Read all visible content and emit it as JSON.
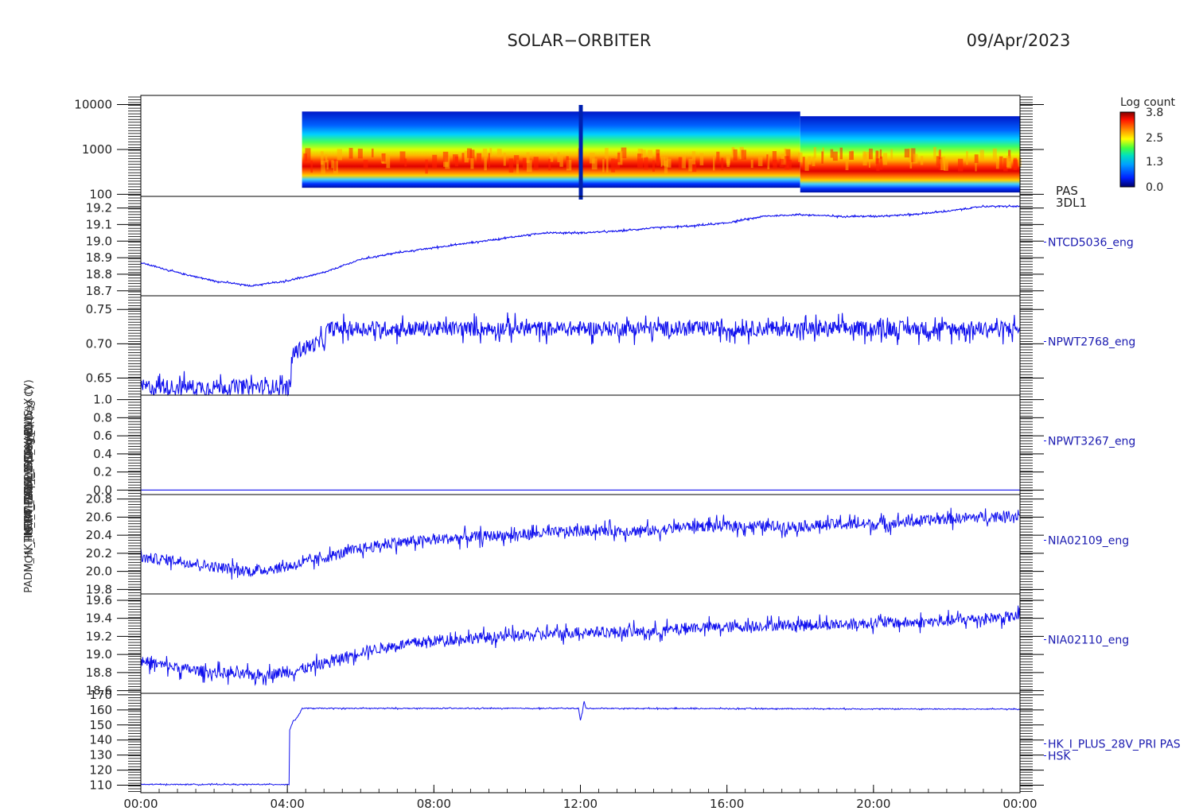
{
  "header": {
    "title": "SOLAR−ORBITER",
    "date": "09/Apr/2023"
  },
  "colorbar": {
    "label": "Log count",
    "ticks": [
      "3.8",
      "2.5",
      "1.3",
      "0.0"
    ],
    "values": [
      3.8,
      2.5,
      1.3,
      0.0
    ]
  },
  "colors": {
    "trace": "#1010ee",
    "axis": "#000000"
  },
  "stacked_ylabels": [
    "(eV)",
    "Approx Temp (Deg C)",
    "PWT_TEMP_EBOX_PLUS_X (V)",
    "SWA_EAS_LVPS_5V_C (V)",
    "THERM_ACU_1 (Deg C)",
    "MON_HK_I_THERM_2 (Deg C)",
    "PADM_HK_IMON_PLUS28V (mA)"
  ],
  "chart_data": [
    {
      "type": "heatmap",
      "panel": "spectrogram",
      "side_labels": [
        "PAS",
        "3DL1"
      ],
      "ylabel": "(eV)",
      "yscale": "log",
      "ylim": [
        90,
        16000
      ],
      "yticks": [
        100,
        1000,
        10000
      ],
      "ytick_labels": [
        "100",
        "1000",
        "10000"
      ],
      "data_start_hour": 4.4,
      "energy_peak_eV": 650,
      "upper_edge_eV": [
        {
          "from_hour": 4.4,
          "to_hour": 18.0,
          "eV": 7000
        },
        {
          "from_hour": 18.0,
          "to_hour": 24.0,
          "eV": 5500
        }
      ],
      "lower_edge_eV": [
        {
          "from_hour": 4.4,
          "to_hour": 18.0,
          "eV": 140
        },
        {
          "from_hour": 18.0,
          "to_hour": 24.0,
          "eV": 110
        }
      ],
      "log_count_range": [
        0.0,
        3.8
      ]
    },
    {
      "type": "line",
      "panel": "NTCD5036_eng",
      "side_labels": [
        "NTCD5036_eng"
      ],
      "ylabel": "Approx Temp (Deg C)",
      "ylim": [
        18.67,
        19.27
      ],
      "yticks": [
        18.7,
        18.8,
        18.9,
        19.0,
        19.1,
        19.2
      ],
      "ytick_labels": [
        "18.7",
        "18.8",
        "18.9",
        "19.0",
        "19.1",
        "19.2"
      ],
      "x": [
        0,
        1,
        2,
        3,
        4,
        5,
        6,
        7,
        8,
        9,
        10,
        11,
        12,
        13,
        14,
        15,
        16,
        17,
        18,
        19,
        20,
        21,
        22,
        23,
        24
      ],
      "y": [
        18.87,
        18.81,
        18.76,
        18.73,
        18.76,
        18.81,
        18.89,
        18.93,
        18.96,
        18.99,
        19.02,
        19.05,
        19.05,
        19.06,
        19.08,
        19.09,
        19.11,
        19.15,
        19.16,
        19.15,
        19.15,
        19.16,
        19.18,
        19.21,
        19.21
      ],
      "noise": 0.004
    },
    {
      "type": "line",
      "panel": "NPWT2768_eng",
      "side_labels": [
        "NPWT2768_eng"
      ],
      "ylabel": "PWT_TEMP_EBOX_PLUS_X (V)",
      "ylim": [
        0.625,
        0.77
      ],
      "yticks": [
        0.65,
        0.7,
        0.75
      ],
      "ytick_labels": [
        "0.65",
        "0.70",
        "0.75"
      ],
      "x": [
        0,
        4.1,
        4.1,
        4.6,
        5.0,
        5.1,
        24
      ],
      "y": [
        0.637,
        0.637,
        0.685,
        0.697,
        0.703,
        0.722,
        0.722
      ],
      "noise": 0.011
    },
    {
      "type": "line",
      "panel": "NPWT3267_eng",
      "side_labels": [
        "NPWT3267_eng"
      ],
      "ylabel": "SWA_EAS_LVPS_5V_C (V)",
      "ylim": [
        -0.05,
        1.05
      ],
      "yticks": [
        0.0,
        0.2,
        0.4,
        0.6,
        0.8,
        1.0
      ],
      "ytick_labels": [
        "0.0",
        "0.2",
        "0.4",
        "0.6",
        "0.8",
        "1.0"
      ],
      "x": [
        0,
        24
      ],
      "y": [
        0.0,
        0.0
      ],
      "noise": 0
    },
    {
      "type": "line",
      "panel": "NIA02109_eng",
      "side_labels": [
        "NIA02109_eng"
      ],
      "ylabel": "THERM_ACU_1 (Deg C)",
      "ylim": [
        19.75,
        20.85
      ],
      "yticks": [
        19.8,
        20.0,
        20.2,
        20.4,
        20.6,
        20.8
      ],
      "ytick_labels": [
        "19.8",
        "20.0",
        "20.2",
        "20.4",
        "20.6",
        "20.8"
      ],
      "x": [
        0,
        1,
        2,
        3,
        4,
        5,
        6,
        7,
        8,
        9,
        10,
        11,
        12,
        13,
        14,
        15,
        16,
        17,
        18,
        19,
        20,
        21,
        22,
        23,
        24
      ],
      "y": [
        20.15,
        20.12,
        20.05,
        20.0,
        20.05,
        20.15,
        20.25,
        20.32,
        20.35,
        20.38,
        20.4,
        20.42,
        20.45,
        20.45,
        20.45,
        20.5,
        20.5,
        20.5,
        20.5,
        20.52,
        20.52,
        20.55,
        20.58,
        20.6,
        20.62
      ],
      "noise": 0.06
    },
    {
      "type": "line",
      "panel": "NIA02110_eng",
      "side_labels": [
        "NIA02110_eng"
      ],
      "ylabel": "MON_HK_I_THERM_2 (Deg C)",
      "ylim": [
        18.57,
        19.67
      ],
      "yticks": [
        18.6,
        18.8,
        19.0,
        19.2,
        19.4,
        19.6
      ],
      "ytick_labels": [
        "18.6",
        "18.8",
        "19.0",
        "19.2",
        "19.4",
        "19.6"
      ],
      "x": [
        0,
        1,
        2,
        3,
        4,
        5,
        6,
        7,
        8,
        9,
        10,
        11,
        12,
        13,
        14,
        15,
        16,
        17,
        18,
        19,
        20,
        21,
        22,
        23,
        24
      ],
      "y": [
        18.93,
        18.85,
        18.8,
        18.77,
        18.8,
        18.9,
        19.03,
        19.1,
        19.15,
        19.18,
        19.2,
        19.22,
        19.25,
        19.25,
        19.25,
        19.3,
        19.3,
        19.32,
        19.33,
        19.33,
        19.35,
        19.35,
        19.37,
        19.4,
        19.42
      ],
      "noise": 0.06
    },
    {
      "type": "line",
      "panel": "HK_I_PLUS_28V_PRI PAS HSK",
      "side_labels": [
        "HK_I_PLUS_28V_PRI PAS",
        "HSK"
      ],
      "ylabel": "PADM_HK_IMON_PLUS28V (mA)",
      "ylim": [
        105,
        171
      ],
      "yticks": [
        110,
        120,
        130,
        140,
        150,
        160,
        170
      ],
      "ytick_labels": [
        "110",
        "120",
        "130",
        "140",
        "150",
        "160",
        "170"
      ],
      "x": [
        0,
        4.05,
        4.05,
        4.15,
        4.3,
        4.4,
        11.95,
        12.0,
        12.05,
        12.1,
        12.15,
        24
      ],
      "y": [
        110.5,
        110.5,
        146,
        152,
        156,
        161,
        161,
        153,
        158,
        166,
        161,
        160.5
      ],
      "noise": 0.3
    }
  ],
  "xaxis": {
    "xlim": [
      0,
      24
    ],
    "ticks": [
      0,
      4,
      8,
      12,
      16,
      20,
      24
    ],
    "tick_labels": [
      "00:00",
      "04:00",
      "08:00",
      "12:00",
      "16:00",
      "20:00",
      "00:00"
    ]
  }
}
